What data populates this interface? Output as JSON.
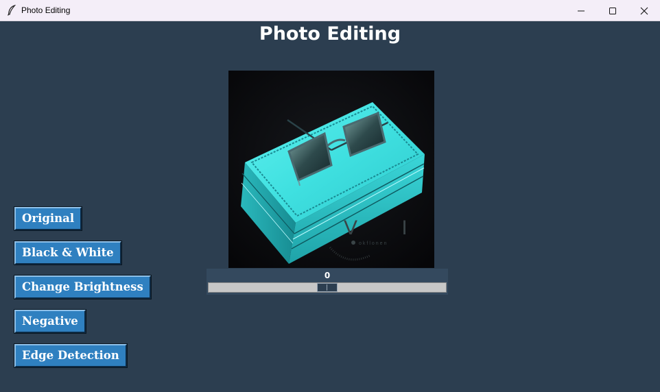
{
  "window": {
    "title": "Photo Editing",
    "controls": [
      "minimize",
      "maximize",
      "close"
    ]
  },
  "heading": "Photo Editing",
  "buttons": [
    {
      "label": "Original"
    },
    {
      "label": "Black & White"
    },
    {
      "label": "Change Brightness"
    },
    {
      "label": "Negative"
    },
    {
      "label": "Edge Detection"
    }
  ],
  "image": {
    "watermark": "V I P",
    "watermark_sub": "okflonen"
  },
  "scale": {
    "value": "0",
    "from": -100,
    "to": 100
  },
  "colors": {
    "background": "#2c3e50",
    "button": "#2f80c0",
    "scale_bg": "#34495e",
    "trough": "#c7c7c7"
  }
}
